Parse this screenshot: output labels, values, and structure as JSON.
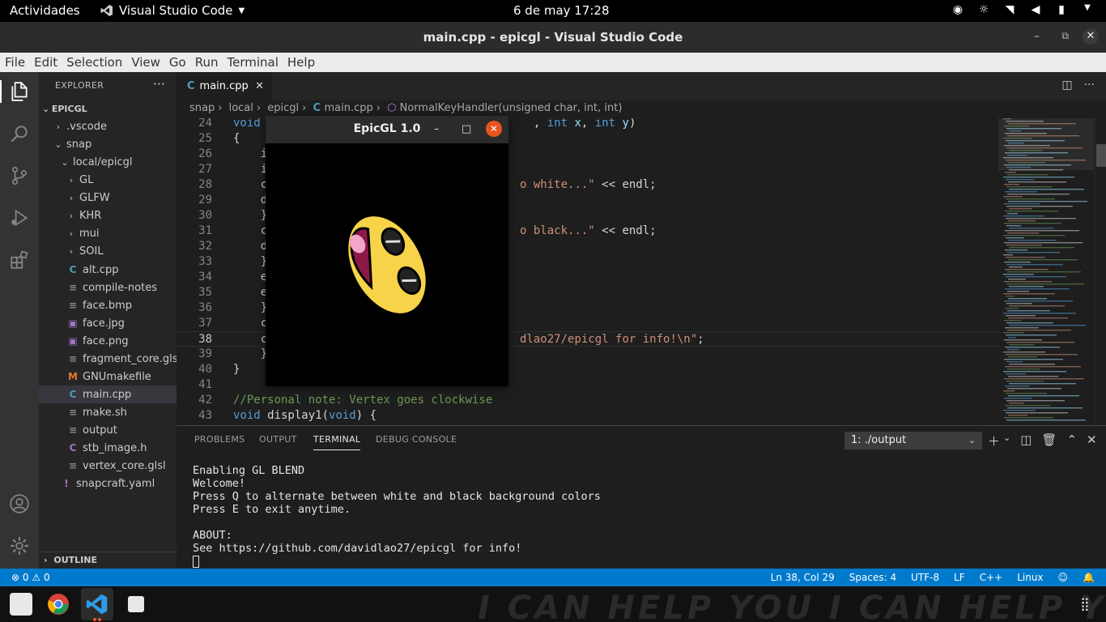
{
  "topbar": {
    "activities": "Actividades",
    "app_name": "Visual Studio Code",
    "clock": "6 de may  17:28"
  },
  "window": {
    "title": "main.cpp - epicgl - Visual Studio Code"
  },
  "menu": [
    "File",
    "Edit",
    "Selection",
    "View",
    "Go",
    "Run",
    "Terminal",
    "Help"
  ],
  "explorer": {
    "header": "EXPLORER",
    "root": "EPICGL",
    "items": [
      {
        "label": ".vscode",
        "type": "folder-closed",
        "depth": 1
      },
      {
        "label": "snap",
        "type": "folder-open",
        "depth": 1
      },
      {
        "label": "local/epicgl",
        "type": "folder-open",
        "depth": 2
      },
      {
        "label": "GL",
        "type": "folder-closed",
        "depth": 3
      },
      {
        "label": "GLFW",
        "type": "folder-closed",
        "depth": 3
      },
      {
        "label": "KHR",
        "type": "folder-closed",
        "depth": 3
      },
      {
        "label": "mui",
        "type": "folder-closed",
        "depth": 3
      },
      {
        "label": "SOIL",
        "type": "folder-closed",
        "depth": 3
      },
      {
        "label": "alt.cpp",
        "type": "cpp",
        "depth": 3
      },
      {
        "label": "compile-notes",
        "type": "text",
        "depth": 3
      },
      {
        "label": "face.bmp",
        "type": "text",
        "depth": 3
      },
      {
        "label": "face.jpg",
        "type": "image",
        "depth": 3
      },
      {
        "label": "face.png",
        "type": "image",
        "depth": 3
      },
      {
        "label": "fragment_core.glsl",
        "type": "text",
        "depth": 3
      },
      {
        "label": "GNUmakefile",
        "type": "make",
        "depth": 3
      },
      {
        "label": "main.cpp",
        "type": "cpp",
        "depth": 3,
        "selected": true
      },
      {
        "label": "make.sh",
        "type": "text",
        "depth": 3
      },
      {
        "label": "output",
        "type": "text",
        "depth": 3
      },
      {
        "label": "stb_image.h",
        "type": "c",
        "depth": 3
      },
      {
        "label": "vertex_core.glsl",
        "type": "text",
        "depth": 3
      },
      {
        "label": "snapcraft.yaml",
        "type": "yaml",
        "depth": 2
      }
    ],
    "outline": "OUTLINE"
  },
  "editor": {
    "tab": "main.cpp",
    "breadcrumb": [
      "snap",
      "local",
      "epicgl",
      "main.cpp",
      "NormalKeyHandler(unsigned char, int, int)"
    ],
    "lines": [
      {
        "n": "24",
        "segs": [
          {
            "c": "kw",
            "t": "void"
          },
          {
            "c": "plain",
            "t": "                                        "
          },
          {
            "c": "plain",
            "t": ", "
          },
          {
            "c": "kw",
            "t": "int"
          },
          {
            "c": "plain",
            "t": " "
          },
          {
            "c": "id",
            "t": "x"
          },
          {
            "c": "plain",
            "t": ", "
          },
          {
            "c": "kw",
            "t": "int"
          },
          {
            "c": "plain",
            "t": " "
          },
          {
            "c": "id",
            "t": "y"
          },
          {
            "c": "plain",
            "t": ")"
          }
        ]
      },
      {
        "n": "25",
        "segs": [
          {
            "c": "plain",
            "t": "{"
          }
        ]
      },
      {
        "n": "26",
        "segs": [
          {
            "c": "plain",
            "t": "    i"
          }
        ]
      },
      {
        "n": "27",
        "segs": [
          {
            "c": "plain",
            "t": "    i"
          }
        ]
      },
      {
        "n": "28",
        "segs": [
          {
            "c": "plain",
            "t": "    c                                     "
          },
          {
            "c": "str",
            "t": "o white...\""
          },
          {
            "c": "plain",
            "t": " << endl;"
          }
        ]
      },
      {
        "n": "29",
        "segs": [
          {
            "c": "plain",
            "t": "    d"
          }
        ]
      },
      {
        "n": "30",
        "segs": [
          {
            "c": "plain",
            "t": "    }"
          }
        ]
      },
      {
        "n": "31",
        "segs": [
          {
            "c": "plain",
            "t": "    c                                     "
          },
          {
            "c": "str",
            "t": "o black...\""
          },
          {
            "c": "plain",
            "t": " << endl;"
          }
        ]
      },
      {
        "n": "32",
        "segs": [
          {
            "c": "plain",
            "t": "    d"
          }
        ]
      },
      {
        "n": "33",
        "segs": [
          {
            "c": "plain",
            "t": "    }"
          }
        ]
      },
      {
        "n": "34",
        "segs": [
          {
            "c": "plain",
            "t": "    e"
          }
        ]
      },
      {
        "n": "35",
        "segs": [
          {
            "c": "plain",
            "t": "    e"
          }
        ]
      },
      {
        "n": "36",
        "segs": [
          {
            "c": "plain",
            "t": "    }"
          }
        ]
      },
      {
        "n": "37",
        "segs": [
          {
            "c": "plain",
            "t": "    c"
          }
        ]
      },
      {
        "n": "38",
        "segs": [
          {
            "c": "plain",
            "t": "    c                                     "
          },
          {
            "c": "str",
            "t": "dlao27/epicgl for info!\\n\""
          },
          {
            "c": "plain",
            "t": ";"
          }
        ],
        "current": true
      },
      {
        "n": "39",
        "segs": [
          {
            "c": "plain",
            "t": "    }"
          }
        ]
      },
      {
        "n": "40",
        "segs": [
          {
            "c": "plain",
            "t": "}"
          }
        ]
      },
      {
        "n": "41",
        "segs": [
          {
            "c": "plain",
            "t": ""
          }
        ]
      },
      {
        "n": "42",
        "segs": [
          {
            "c": "com",
            "t": "//Personal note: Vertex goes clockwise"
          }
        ]
      },
      {
        "n": "43",
        "segs": [
          {
            "c": "kw",
            "t": "void"
          },
          {
            "c": "plain",
            "t": " display1("
          },
          {
            "c": "kw",
            "t": "void"
          },
          {
            "c": "plain",
            "t": ") {"
          }
        ]
      }
    ]
  },
  "glwindow": {
    "title": "EpicGL 1.0"
  },
  "panel": {
    "tabs": [
      "PROBLEMS",
      "OUTPUT",
      "TERMINAL",
      "DEBUG CONSOLE"
    ],
    "active_tab": "TERMINAL",
    "terminal_select": "1: ./output",
    "terminal_lines": [
      "Enabling GL BLEND",
      "Welcome!",
      "Press Q to alternate between white and black background colors",
      "Press E to exit anytime.",
      "",
      "ABOUT:",
      "See https://github.com/davidlao27/epicgl for info!"
    ]
  },
  "status": {
    "errors": "0",
    "warnings": "0",
    "position": "Ln 38, Col 29",
    "spaces": "Spaces: 4",
    "encoding": "UTF-8",
    "eol": "LF",
    "language": "C++",
    "os": "Linux"
  },
  "colors": {
    "statusbar": "#007acc",
    "accent_close": "#e95420",
    "face_yellow": "#f7d34a",
    "face_mouth": "#8b1a48"
  }
}
